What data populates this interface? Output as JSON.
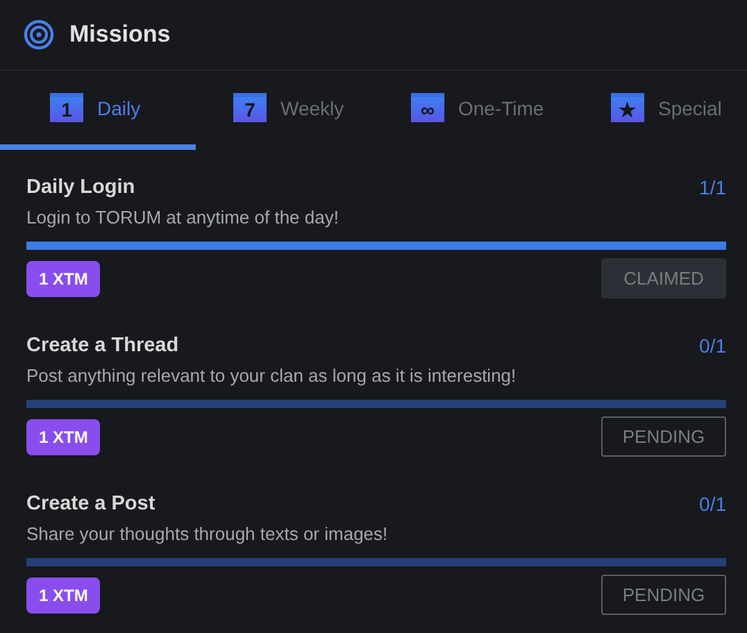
{
  "window": {
    "title": "Missions"
  },
  "tabs": [
    {
      "label": "Daily",
      "glyph": "1",
      "selected": true
    },
    {
      "label": "Weekly",
      "glyph": "7",
      "selected": false
    },
    {
      "label": "One-Time",
      "glyph": "∞",
      "selected": false
    },
    {
      "label": "Special",
      "glyph": "★",
      "selected": false
    }
  ],
  "missions": [
    {
      "title": "Daily Login",
      "description": "Login to TORUM at anytime of the day!",
      "progress": "1/1",
      "level": 1,
      "reward": "1 XTM",
      "claimed": true,
      "action": "CLAIMED"
    },
    {
      "title": "Create a Thread",
      "description": "Post anything relevant to your clan as long as it is interesting!",
      "progress": "0/1",
      "level": 0,
      "reward": "1 XTM",
      "claimed": false,
      "action": "PENDING"
    },
    {
      "title": "Create a Post",
      "description": "Share your thoughts through texts or images!",
      "progress": "0/1",
      "level": 0,
      "reward": "1 XTM",
      "claimed": false,
      "action": "PENDING"
    }
  ]
}
